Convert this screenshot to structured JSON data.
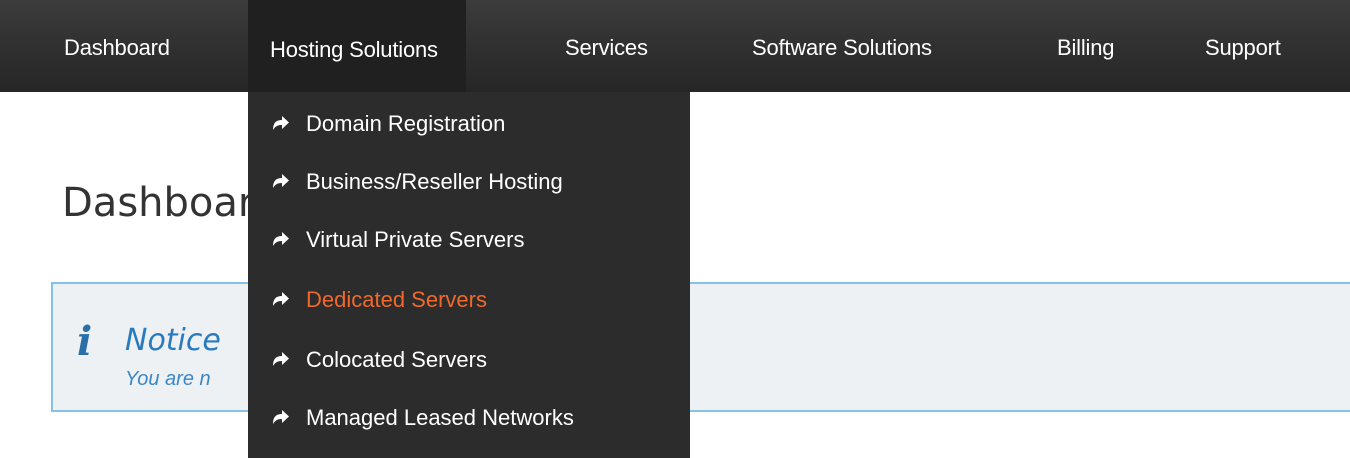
{
  "nav": {
    "items": [
      {
        "label": "Dashboard"
      },
      {
        "label": "Hosting Solutions"
      },
      {
        "label": "Services"
      },
      {
        "label": "Software Solutions"
      },
      {
        "label": "Billing"
      },
      {
        "label": "Support"
      }
    ],
    "active": "Hosting Solutions"
  },
  "dropdown": {
    "icon": "forward-arrow-icon",
    "items": [
      {
        "label": "Domain Registration"
      },
      {
        "label": "Business/Reseller Hosting"
      },
      {
        "label": "Virtual Private Servers"
      },
      {
        "label": "Dedicated Servers",
        "highlighted": true
      },
      {
        "label": "Colocated Servers"
      },
      {
        "label": "Managed Leased Networks"
      }
    ]
  },
  "page": {
    "title": "Dashboard"
  },
  "notice": {
    "icon": "info-icon",
    "title": "Notice",
    "text": "You are n"
  },
  "colors": {
    "navbar": "#2f2f2f",
    "dropdown": "#2c2c2c",
    "highlight": "#f0682a",
    "notice_border": "#85c1e9",
    "notice_bg": "#eef1f4",
    "notice_text": "#2a7bbd"
  }
}
